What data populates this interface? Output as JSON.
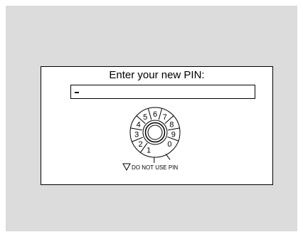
{
  "dialog": {
    "title": "Enter your new PIN:",
    "pin_value": "-"
  },
  "dial": {
    "digits": [
      "0",
      "1",
      "2",
      "3",
      "4",
      "5",
      "6",
      "7",
      "8",
      "9"
    ],
    "skip_label": "DO NOT USE PIN",
    "skip_icon": "down-triangle-icon"
  },
  "colors": {
    "screen_background": "#dcdcdc",
    "panel_background": "#ffffff",
    "ink": "#000000"
  }
}
